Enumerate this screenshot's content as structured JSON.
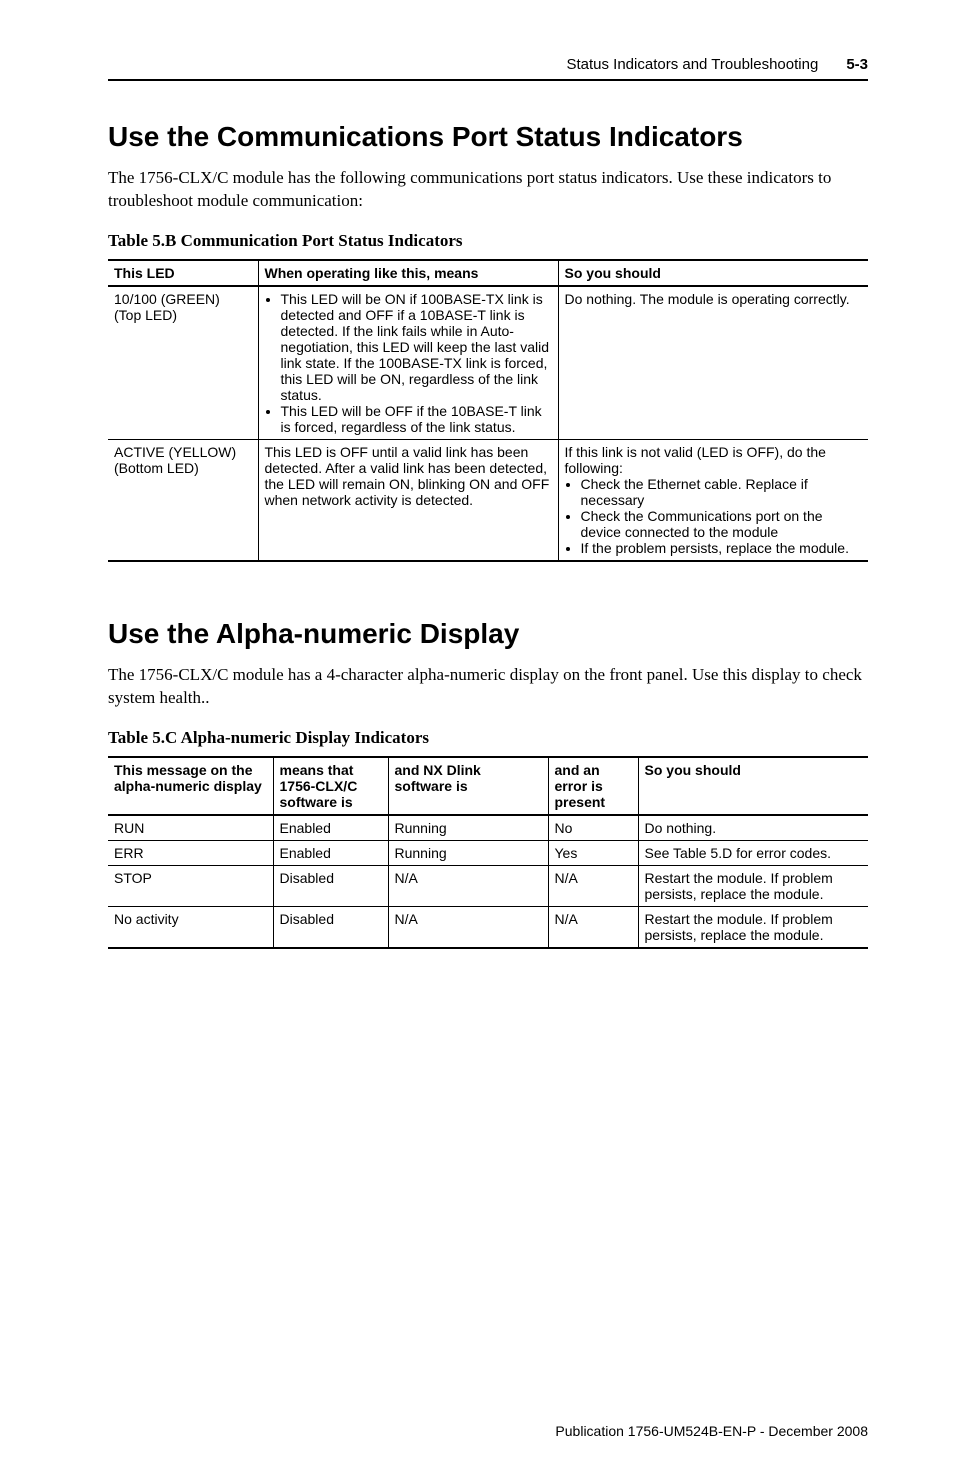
{
  "header": {
    "running_title": "Status Indicators and Troubleshooting",
    "page_num": "5-3"
  },
  "section1": {
    "heading": "Use the Communications Port Status Indicators",
    "body": "The 1756-CLX/C module has the following communications port status indicators. Use these indicators to troubleshoot module communication:",
    "caption": "Table 5.B Communication Port Status Indicators",
    "table": {
      "head": {
        "c1": "This LED",
        "c2": "When operating like this, means",
        "c3": "So you should"
      },
      "rows": [
        {
          "c1": "10/100 (GREEN)\n(Top LED)",
          "c2_list": [
            "This LED will be ON if 100BASE-TX link is detected and OFF if a 10BASE-T link is detected. If the link fails while in Auto-negotiation, this LED will keep the last valid link state. If the 100BASE-TX link is forced, this LED will be ON, regardless of the link status.",
            " This LED will be OFF if the 10BASE-T link is forced, regardless of the link status."
          ],
          "c3": "Do nothing. The module is operating correctly."
        },
        {
          "c1": "ACTIVE (YELLOW)\n(Bottom LED)",
          "c2": "This LED is OFF until a valid link has been detected. After a valid link has been detected, the LED will remain ON, blinking ON and OFF when network activity is detected.",
          "c3_pre": "If this link is not valid (LED is OFF), do the following:",
          "c3_list": [
            "Check the Ethernet cable. Replace if necessary",
            "Check the Communications port on the device connected to the module",
            "If the problem persists, replace the module."
          ]
        }
      ]
    }
  },
  "section2": {
    "heading": "Use the Alpha-numeric Display",
    "body": "The 1756-CLX/C module has a 4-character alpha-numeric display on the front panel. Use this display to check system health..",
    "caption": "Table 5.C Alpha-numeric Display Indicators",
    "table": {
      "head": {
        "c1": "This message on the alpha-numeric display",
        "c2": "means that 1756-CLX/C software is",
        "c3": "and NX Dlink software is",
        "c4": "and an error is present",
        "c5": "So you should"
      },
      "rows": [
        {
          "c1": "RUN",
          "c2": "Enabled",
          "c3": "Running",
          "c4": "No",
          "c5": "Do nothing."
        },
        {
          "c1": "ERR",
          "c2": "Enabled",
          "c3": "Running",
          "c4": "Yes",
          "c5": "See Table 5.D for error codes."
        },
        {
          "c1": "STOP",
          "c2": "Disabled",
          "c3": "N/A",
          "c4": "N/A",
          "c5": "Restart the module. If problem persists, replace the module."
        },
        {
          "c1": "No activity",
          "c2": "Disabled",
          "c3": "N/A",
          "c4": "N/A",
          "c5": "Restart the module. If problem persists, replace the module."
        }
      ]
    }
  },
  "footer": {
    "pub": "Publication 1756-UM524B-EN-P - December 2008"
  }
}
